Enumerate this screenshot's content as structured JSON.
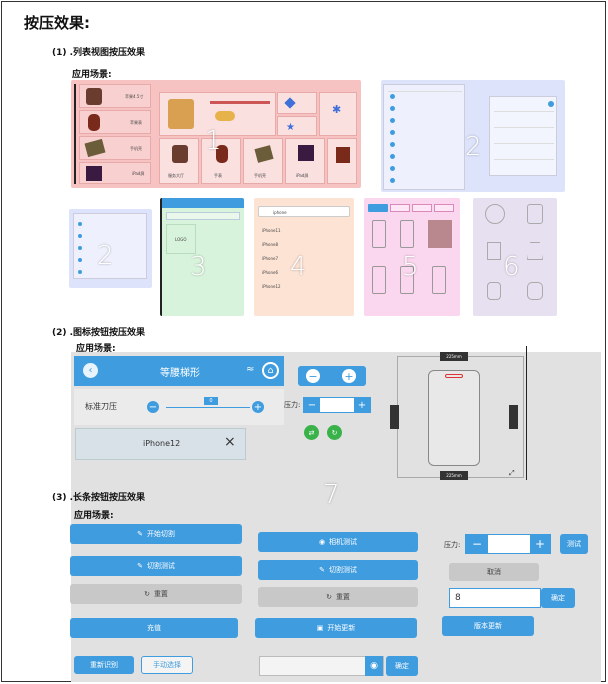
{
  "title": "按压效果:",
  "section1": {
    "heading": "(1) .列表视图按压效果",
    "scene": "应用场景:"
  },
  "section2": {
    "heading": "(2) .图标按钮按压效果",
    "scene": "应用场景:"
  },
  "section3": {
    "heading": "(3) .长条按钮按压效果",
    "scene": "应用场景:"
  },
  "panel_numbers": [
    "1",
    "2",
    "2",
    "3",
    "4",
    "5",
    "6",
    "7"
  ],
  "icon_panel": {
    "header_title": "等腰梯形",
    "slider_label": "标准刀压",
    "slider_value": "0",
    "pressure_label": "压力:",
    "list_item": "iPhone12",
    "phone_width": "225mm",
    "phone_height": "225mm"
  },
  "long_buttons": {
    "start_cut": "开始切割",
    "cut_test": "切割测试",
    "reset": "重置",
    "charge": "充值",
    "camera_test": "相机测试",
    "cut_test2": "切割测试",
    "reset2": "重置",
    "start_update": "开始更新",
    "pressure_label": "压力:",
    "test": "测试",
    "cancel": "取消",
    "input_value": "8",
    "confirm": "确定",
    "version_update": "版本更新",
    "re_identify": "重新识别",
    "manual_select": "手动选择",
    "confirm2": "确定"
  },
  "mini_text": {
    "p1_items": [
      "苹果4.5寸",
      "苹果表",
      "手机壳",
      "iPad屏"
    ],
    "p1_labels": [
      "服务大厅",
      "手表",
      "手机壳",
      "iPad屏"
    ],
    "p3_btn": "LOGO",
    "p4_items": [
      "iPhone11",
      "iPhone8",
      "iPhone7",
      "iPhone6",
      "iPhone12"
    ],
    "p4_search": "iphone"
  },
  "colors": {
    "accent": "#3f9cdf",
    "panel1": "#f7c2c2",
    "panel2": "#dde3fb",
    "panel3": "#d8f3dc",
    "panel4": "#fde3d4",
    "panel5": "#fbd7ef",
    "panel6": "#e7e0f1",
    "gray_bg": "#e1e1e1"
  }
}
